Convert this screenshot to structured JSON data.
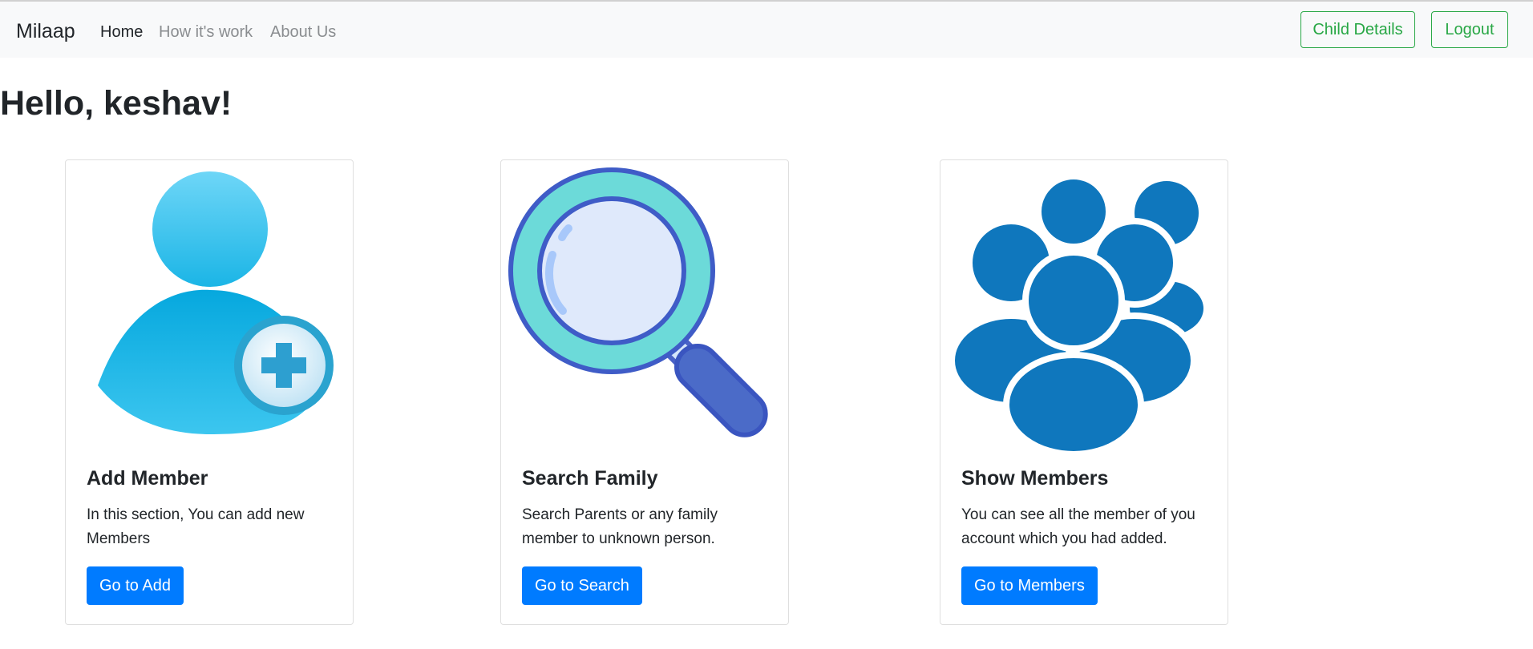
{
  "navbar": {
    "brand": "Milaap",
    "links": [
      "Home",
      "How it's work",
      "About Us"
    ],
    "buttons": [
      "Child Details",
      "Logout"
    ],
    "accent_color": "#28a745"
  },
  "greeting": "Hello, keshav!",
  "cards": [
    {
      "icon": "add-user-icon",
      "title": "Add Member",
      "text": "In this section, You can add new Members",
      "button": "Go to Add"
    },
    {
      "icon": "magnifier-icon",
      "title": "Search Family",
      "text": "Search Parents or any family member to unknown person.",
      "button": "Go to Search"
    },
    {
      "icon": "group-icon",
      "title": "Show Members",
      "text": "You can see all the member of you account which you had added.",
      "button": "Go to Members"
    }
  ],
  "primary_color": "#007bff"
}
